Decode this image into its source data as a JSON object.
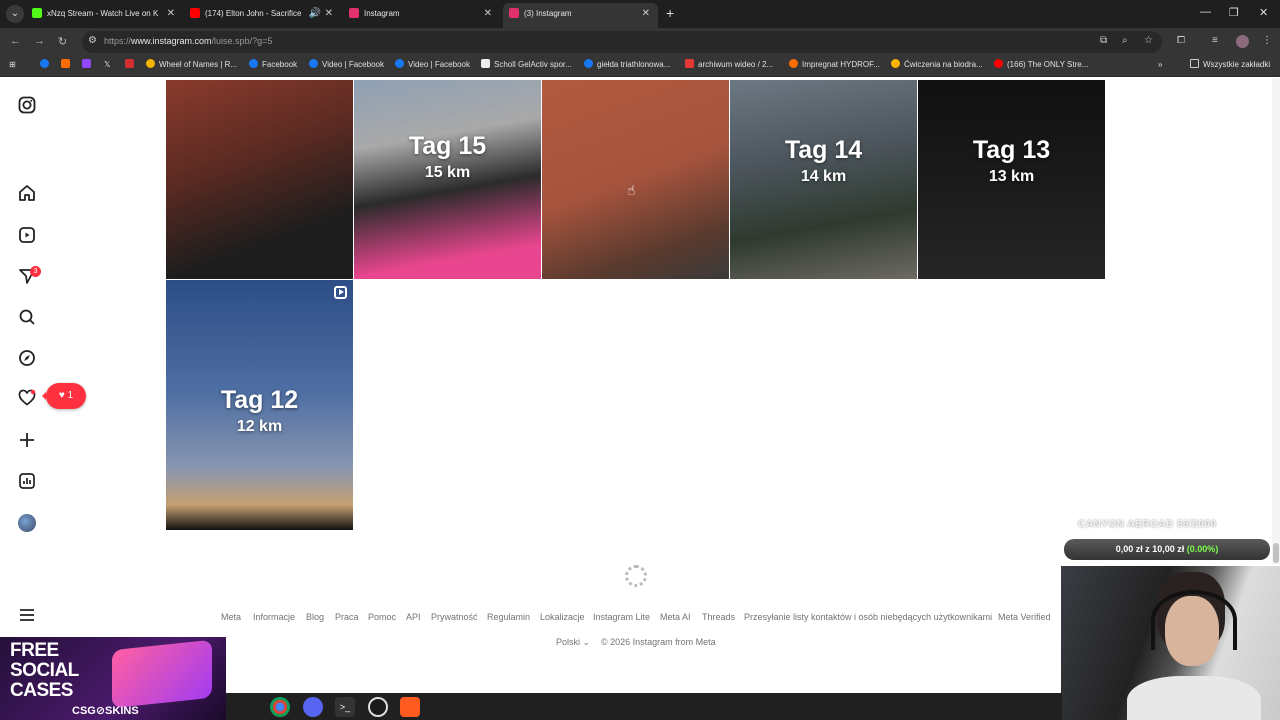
{
  "browser": {
    "tabs": [
      {
        "title": "xNzq Stream - Watch Live on K",
        "color": "#53fc18",
        "active": false
      },
      {
        "title": "(174) Elton John - Sacrifice",
        "color": "#ff0000",
        "active": false
      },
      {
        "title": "Instagram",
        "color": "#e1306c",
        "active": false
      },
      {
        "title": "(3) Instagram",
        "color": "#e1306c",
        "active": true
      }
    ],
    "url_prefix": "https://",
    "url_host": "www.instagram.com",
    "url_path": "/luise.spb/?g=5",
    "bookmarks": [
      {
        "label": "Wheel of Names | R...",
        "color": "#f4b400"
      },
      {
        "label": "Facebook",
        "color": "#1877f2"
      },
      {
        "label": "Video | Facebook",
        "color": "#1877f2"
      },
      {
        "label": "Video | Facebook",
        "color": "#1877f2"
      },
      {
        "label": "Scholl GelActiv spor...",
        "color": "#eeeeee"
      },
      {
        "label": "giełda triathlonowa...",
        "color": "#1877f2"
      },
      {
        "label": "archiwum wideo / 2...",
        "color": "#e53935"
      },
      {
        "label": "Impregnat HYDROF...",
        "color": "#ff6d00"
      },
      {
        "label": "Ćwiczenia na biodra...",
        "color": "#ffb300"
      },
      {
        "label": "(166) The ONLY Stre...",
        "color": "#ff0000"
      }
    ],
    "all_bookmarks": "Wszystkie zakładki"
  },
  "posts": [
    {
      "title": "",
      "subtitle": "",
      "bg": "linear-gradient(160deg,#8a3b2c,#5b2a22 40%,#1d1d1d 75%)",
      "reel": false
    },
    {
      "title": "Tag 15",
      "subtitle": "15 km",
      "bg": "linear-gradient(170deg,#8fa0b4,#a9a9a9 30%,#2b2b2b 55%,#e8468e 85%)",
      "reel": false
    },
    {
      "title": "",
      "subtitle": "",
      "bg": "linear-gradient(160deg,#b35a40,#a5533d 50%,#5a3a2e 80%,#3a3a3a)",
      "reel": false
    },
    {
      "title": "Tag 14",
      "subtitle": "14 km",
      "bg": "linear-gradient(170deg,#6d7883,#4b545b 40%,#2f3a2f 70%,#6d6a62)",
      "reel": false
    },
    {
      "title": "Tag 13",
      "subtitle": "13 km",
      "bg": "linear-gradient(180deg,#111,#1a1a1a 50%,#262626)",
      "reel": false
    },
    {
      "title": "Tag 12",
      "subtitle": "12 km",
      "bg": "linear-gradient(180deg,#2d4e86,#4e6fa3 45%,#8895b0 75%,#c4a070 90%,#111)",
      "reel": true
    }
  ],
  "rail": {
    "badge_count": "3",
    "notif_count": "1"
  },
  "footer": {
    "links": [
      "Meta",
      "Informacje",
      "Blog",
      "Praca",
      "Pomoc",
      "API",
      "Prywatność",
      "Regulamin",
      "Lokalizacje",
      "Instagram Lite",
      "Meta AI",
      "Threads",
      "Przesyłanie listy kontaktów i osób niebędących użytkownikami",
      "Meta Verified"
    ],
    "language": "Polski",
    "copyright": "© 2026 Instagram from Meta"
  },
  "overlay": {
    "promo_line1": "FREE",
    "promo_line2": "SOCIAL",
    "promo_line3": "CASES",
    "promo_brand": "CSG⊘SKINS",
    "goal_title": "CANYON AEROAD 56/2000",
    "goal_current": "0,00 zł",
    "goal_sep": "z",
    "goal_target": "10,00 zł",
    "goal_percent": "(0.00%)",
    "goal_percent_color": "#7cfc4a"
  }
}
